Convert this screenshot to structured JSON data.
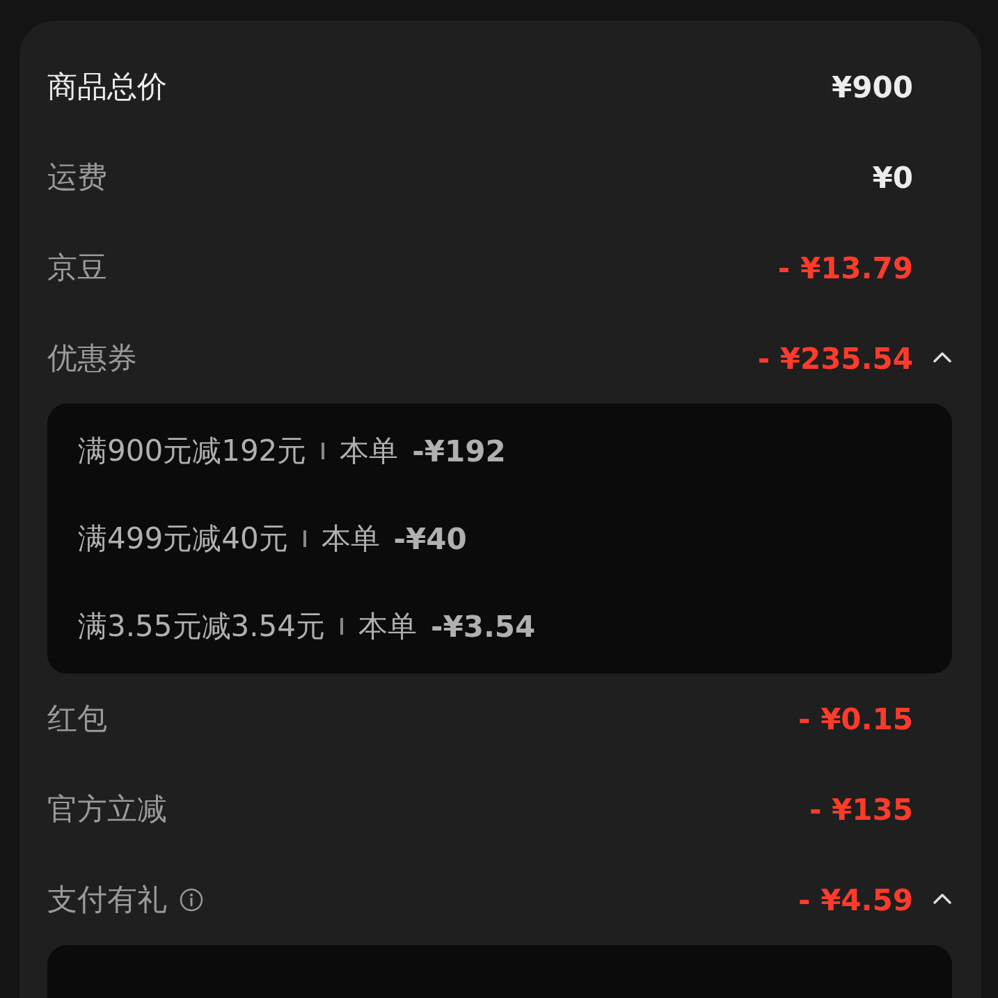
{
  "rows": [
    {
      "kind": "total",
      "label": "商品总价",
      "value": "¥900"
    },
    {
      "kind": "fee",
      "label": "运费",
      "value": "¥0"
    },
    {
      "kind": "discount",
      "label": "京豆",
      "value": "- ¥13.79"
    },
    {
      "kind": "discount",
      "label": "优惠券",
      "value": "- ¥235.54",
      "expanded": true,
      "details": [
        {
          "rule": "满900元减192元",
          "scope": "本单",
          "amount": "-¥192"
        },
        {
          "rule": "满499元减40元",
          "scope": "本单",
          "amount": "-¥40"
        },
        {
          "rule": "满3.55元减3.54元",
          "scope": "本单",
          "amount": "-¥3.54"
        }
      ]
    },
    {
      "kind": "discount",
      "label": "红包",
      "value": "- ¥0.15"
    },
    {
      "kind": "discount",
      "label": "官方立减",
      "value": "- ¥135"
    },
    {
      "kind": "discount",
      "label": "支付有礼",
      "info": true,
      "value": "- ¥4.59",
      "expanded": true
    }
  ]
}
